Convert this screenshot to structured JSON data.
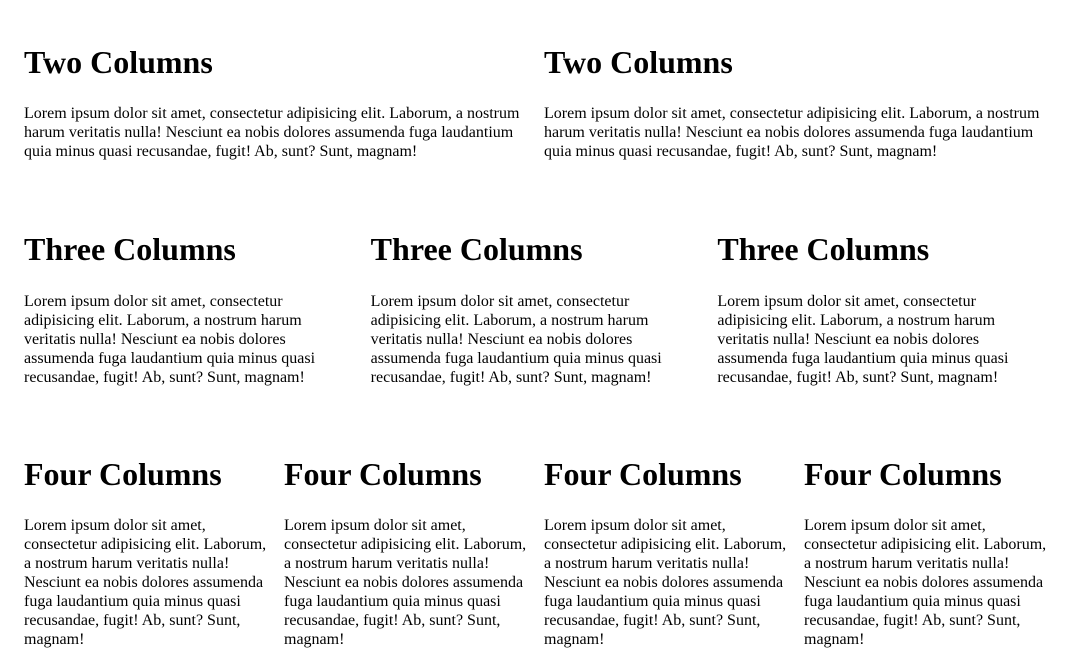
{
  "sections": {
    "two": {
      "columns": [
        {
          "heading": "Two Columns",
          "text": "Lorem ipsum dolor sit amet, consectetur adipisicing elit. Laborum, a nostrum harum veritatis nulla! Nesciunt ea nobis dolores assumenda fuga laudantium quia minus quasi recusandae, fugit! Ab, sunt? Sunt, magnam!"
        },
        {
          "heading": "Two Columns",
          "text": "Lorem ipsum dolor sit amet, consectetur adipisicing elit. Laborum, a nostrum harum veritatis nulla! Nesciunt ea nobis dolores assumenda fuga laudantium quia minus quasi recusandae, fugit! Ab, sunt? Sunt, magnam!"
        }
      ]
    },
    "three": {
      "columns": [
        {
          "heading": "Three Columns",
          "text": "Lorem ipsum dolor sit amet, consectetur adipisicing elit. Laborum, a nostrum harum veritatis nulla! Nesciunt ea nobis dolores assumenda fuga laudantium quia minus quasi recusandae, fugit! Ab, sunt? Sunt, magnam!"
        },
        {
          "heading": "Three Columns",
          "text": "Lorem ipsum dolor sit amet, consectetur adipisicing elit. Laborum, a nostrum harum veritatis nulla! Nesciunt ea nobis dolores assumenda fuga laudantium quia minus quasi recusandae, fugit! Ab, sunt? Sunt, magnam!"
        },
        {
          "heading": "Three Columns",
          "text": "Lorem ipsum dolor sit amet, consectetur adipisicing elit. Laborum, a nostrum harum veritatis nulla! Nesciunt ea nobis dolores assumenda fuga laudantium quia minus quasi recusandae, fugit! Ab, sunt? Sunt, magnam!"
        }
      ]
    },
    "four": {
      "columns": [
        {
          "heading": "Four Columns",
          "text": "Lorem ipsum dolor sit amet, consectetur adipisicing elit. Laborum, a nostrum harum veritatis nulla! Nesciunt ea nobis dolores assumenda fuga laudantium quia minus quasi recusandae, fugit! Ab, sunt? Sunt, magnam!"
        },
        {
          "heading": "Four Columns",
          "text": "Lorem ipsum dolor sit amet, consectetur adipisicing elit. Laborum, a nostrum harum veritatis nulla! Nesciunt ea nobis dolores assumenda fuga laudantium quia minus quasi recusandae, fugit! Ab, sunt? Sunt, magnam!"
        },
        {
          "heading": "Four Columns",
          "text": "Lorem ipsum dolor sit amet, consectetur adipisicing elit. Laborum, a nostrum harum veritatis nulla! Nesciunt ea nobis dolores assumenda fuga laudantium quia minus quasi recusandae, fugit! Ab, sunt? Sunt, magnam!"
        },
        {
          "heading": "Four Columns",
          "text": "Lorem ipsum dolor sit amet, consectetur adipisicing elit. Laborum, a nostrum harum veritatis nulla! Nesciunt ea nobis dolores assumenda fuga laudantium quia minus quasi recusandae, fugit! Ab, sunt? Sunt, magnam!"
        }
      ]
    }
  }
}
